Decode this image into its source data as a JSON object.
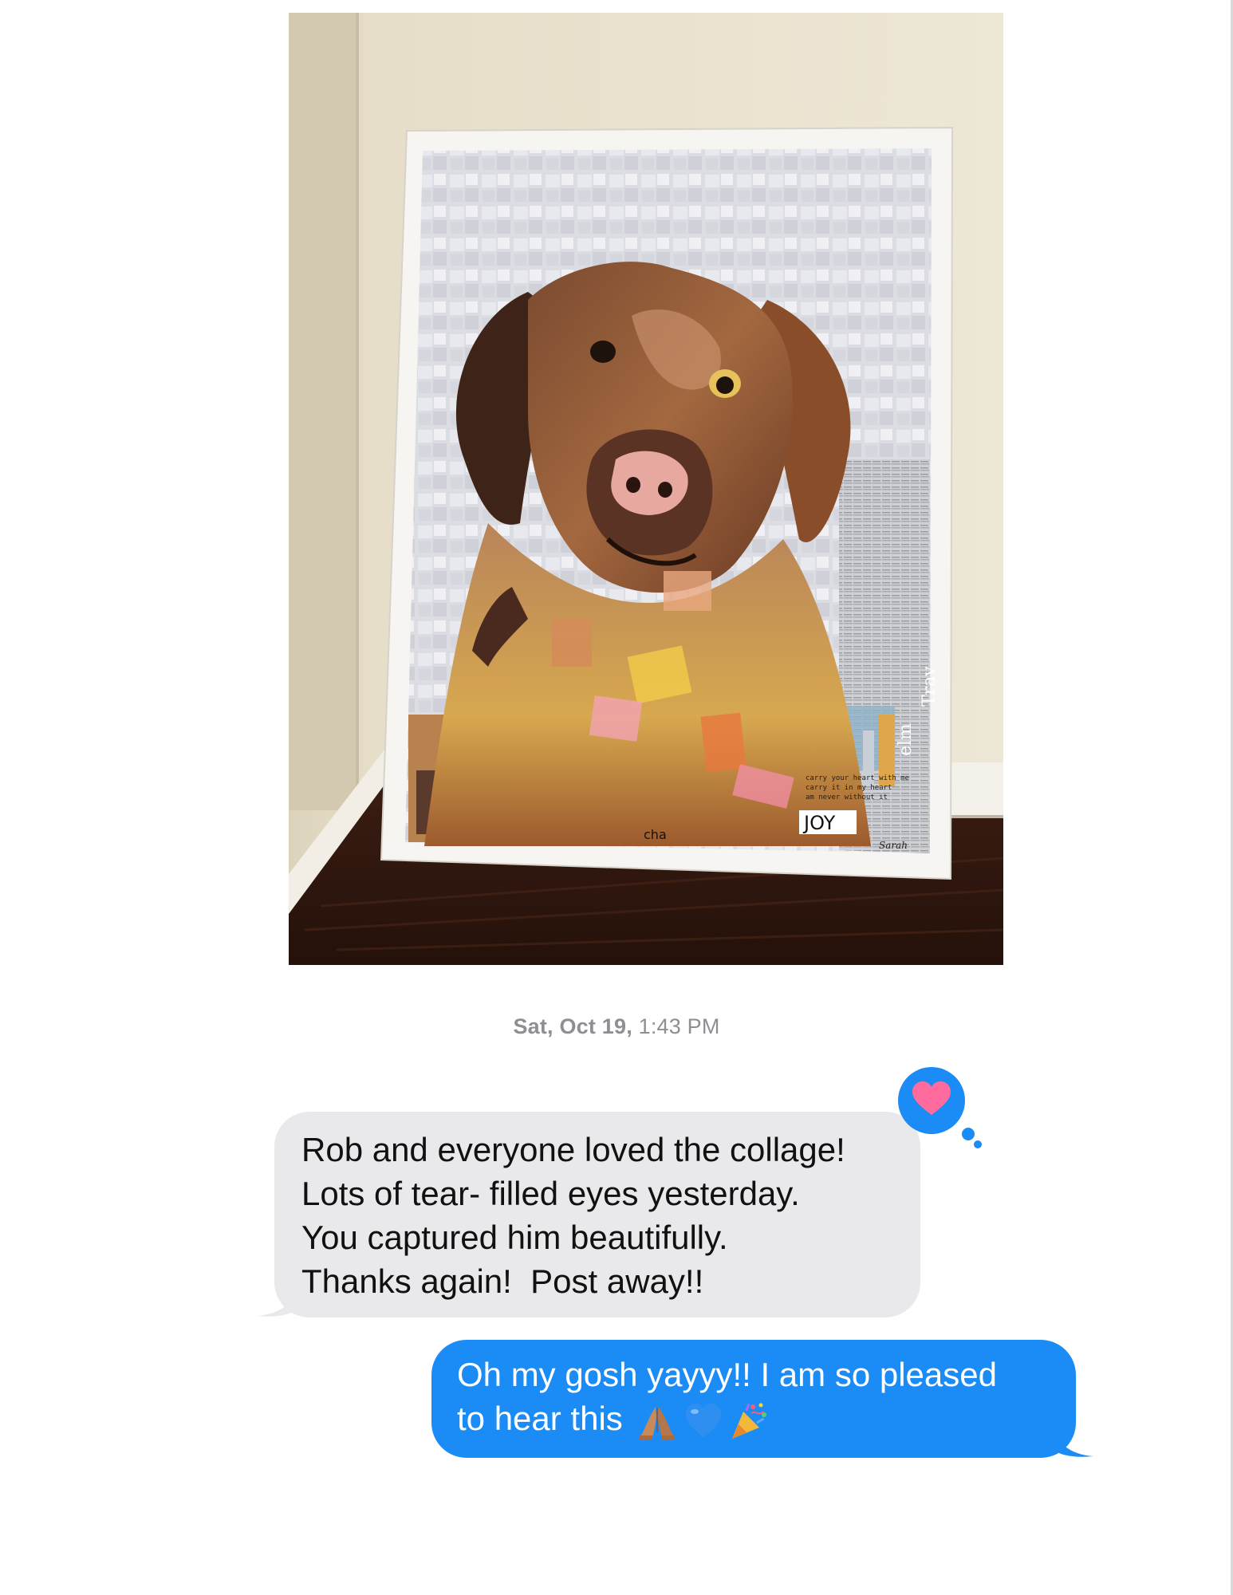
{
  "conversation": {
    "timestamp": {
      "day": "Sat, Oct 19,",
      "time": " 1:43 PM"
    },
    "received_message": {
      "lines": [
        "Rob and everyone loved the collage!",
        "Lots of tear- filled eyes yesterday.",
        "You captured him beautifully.",
        "Thanks again!  Post away!!"
      ],
      "tapback": "heart-icon"
    },
    "sent_message": {
      "lines": [
        "Oh my gosh yayyy!! I am so pleased",
        "to hear this "
      ],
      "emojis": [
        "folded-hands-emoji",
        "blue-heart-emoji",
        "party-popper-emoji"
      ]
    }
  },
  "attachment": {
    "collage_text": {
      "word_joy": "JOY",
      "word_cha": "cha",
      "quote_line_1": "carry your heart with me",
      "quote_line_2": "carry it in my heart",
      "quote_line_3": "am never without it",
      "word_elm": "elm",
      "word_trav": "Trav",
      "signature": "Sarah"
    }
  },
  "colors": {
    "sent_bubble": "#1b8cf5",
    "received_bubble": "#e9e9eb",
    "timestamp": "#8e8e93",
    "tapback_heart": "#ff6b9d"
  }
}
